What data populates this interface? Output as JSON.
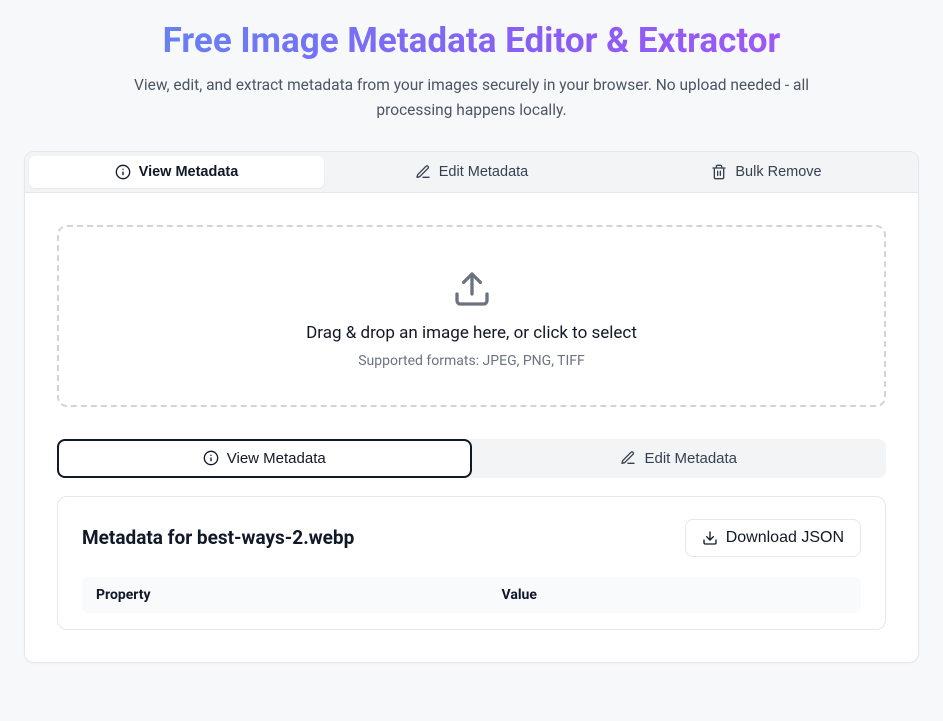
{
  "header": {
    "title": "Free Image Metadata Editor & Extractor",
    "subtitle": "View, edit, and extract metadata from your images securely in your browser. No upload needed - all processing happens locally."
  },
  "tabs": {
    "view": "View Metadata",
    "edit": "Edit Metadata",
    "bulk": "Bulk Remove"
  },
  "dropzone": {
    "text": "Drag & drop an image here, or click to select",
    "sub": "Supported formats: JPEG, PNG, TIFF"
  },
  "subtabs": {
    "view": "View Metadata",
    "edit": "Edit Metadata"
  },
  "meta": {
    "title": "Metadata for best-ways-2.webp",
    "download": "Download JSON",
    "columns": {
      "property": "Property",
      "value": "Value"
    }
  }
}
